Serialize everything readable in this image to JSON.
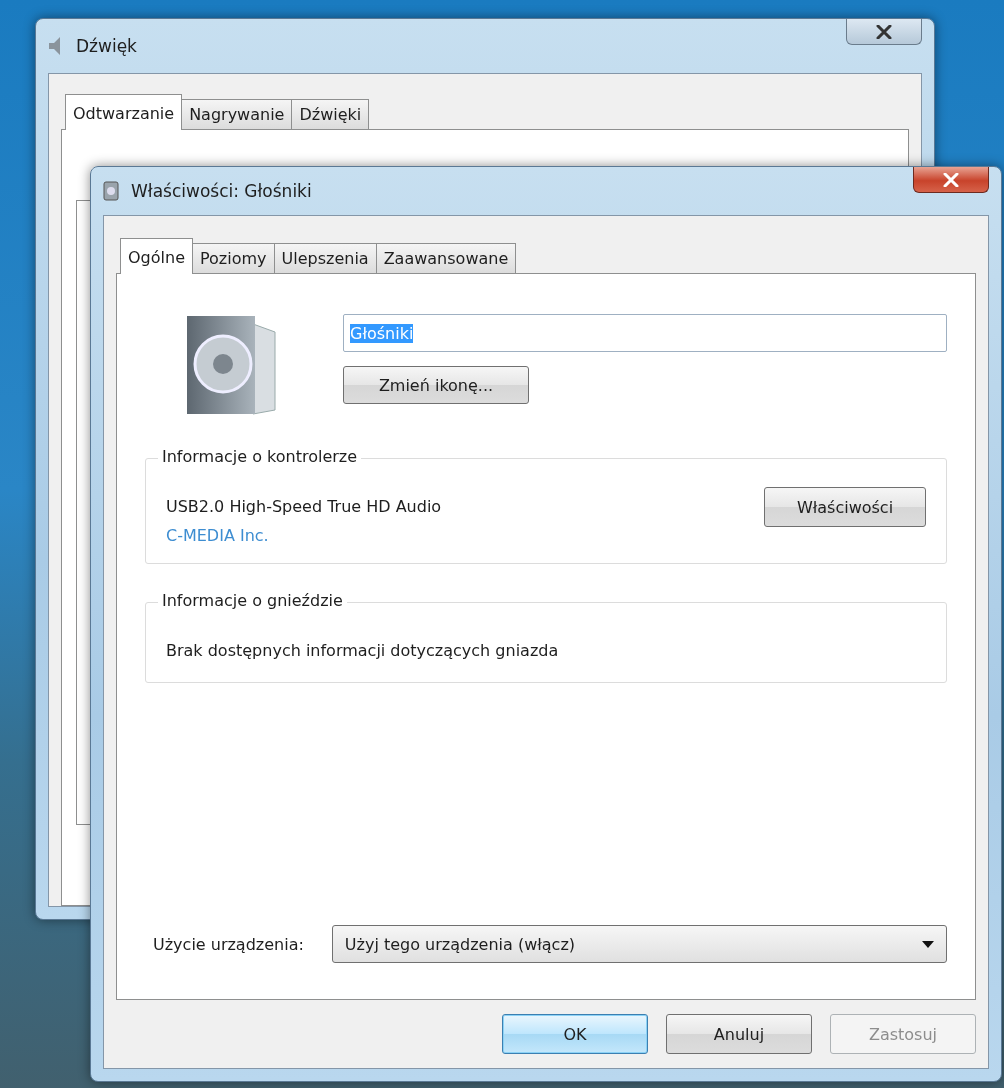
{
  "background_window": {
    "title": "Dźwięk",
    "tabs": [
      {
        "label": "Odtwarzanie",
        "selected": true
      },
      {
        "label": "Nagrywanie",
        "selected": false
      },
      {
        "label": "Dźwięki",
        "selected": false
      }
    ]
  },
  "dialog": {
    "title": "Właściwości: Głośniki",
    "tabs": [
      {
        "label": "Ogólne",
        "selected": true
      },
      {
        "label": "Poziomy",
        "selected": false
      },
      {
        "label": "Ulepszenia",
        "selected": false
      },
      {
        "label": "Zaawansowane",
        "selected": false
      }
    ],
    "device_name": {
      "value": "Głośniki",
      "text_selected": true
    },
    "change_icon_button": "Zmień ikonę...",
    "controller_group": {
      "title": "Informacje o kontrolerze",
      "name": "USB2.0 High-Speed True HD Audio",
      "vendor_link": "C-MEDIA Inc.",
      "properties_button": "Właściwości"
    },
    "jack_group": {
      "title": "Informacje o gnieździe",
      "text": "Brak dostępnych informacji dotyczących gniazda"
    },
    "device_usage": {
      "label": "Użycie urządzenia:",
      "value": "Użyj tego urządzenia (włącz)"
    },
    "buttons": [
      {
        "label": "OK",
        "default": true,
        "disabled": false
      },
      {
        "label": "Anuluj",
        "default": false,
        "disabled": false
      },
      {
        "label": "Zastosuj",
        "default": false,
        "disabled": true
      }
    ]
  }
}
